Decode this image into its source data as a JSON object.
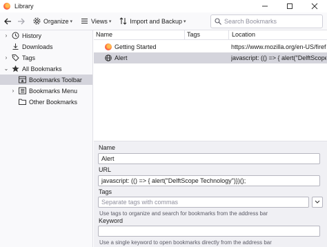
{
  "window": {
    "title": "Library"
  },
  "toolbar": {
    "organize_label": "Organize",
    "views_label": "Views",
    "import_backup_label": "Import and Backup",
    "search_placeholder": "Search Bookmarks"
  },
  "sidebar": {
    "items": [
      {
        "label": "History",
        "icon": "clock-icon",
        "expandable": true
      },
      {
        "label": "Downloads",
        "icon": "download-icon",
        "expandable": false
      },
      {
        "label": "Tags",
        "icon": "tag-icon",
        "expandable": true
      },
      {
        "label": "All Bookmarks",
        "icon": "star-icon",
        "expandable": true,
        "expanded": true
      },
      {
        "label": "Bookmarks Toolbar",
        "icon": "bookmarks-toolbar-icon",
        "selected": true
      },
      {
        "label": "Bookmarks Menu",
        "icon": "bookmarks-menu-icon",
        "expandable": true
      },
      {
        "label": "Other Bookmarks",
        "icon": "folder-icon"
      }
    ]
  },
  "list": {
    "columns": [
      "Name",
      "Tags",
      "Location"
    ],
    "rows": [
      {
        "name": "Getting Started",
        "tags": "",
        "location": "https://www.mozilla.org/en-US/firef...",
        "icon": "firefox-icon"
      },
      {
        "name": "Alert",
        "tags": "",
        "location": "javascript: (() => {  alert(\"DelftScope",
        "icon": "globe-icon",
        "selected": true
      }
    ]
  },
  "details": {
    "name_label": "Name",
    "name_value": "Alert",
    "url_label": "URL",
    "url_value": "javascript: (() => {  alert(\"DelftScope Technology\")})();",
    "tags_label": "Tags",
    "tags_placeholder": "Separate tags with commas",
    "tags_hint": "Use tags to organize and search for bookmarks from the address bar",
    "keyword_label": "Keyword",
    "keyword_value": "",
    "keyword_hint": "Use a single keyword to open bookmarks directly from the address bar"
  }
}
